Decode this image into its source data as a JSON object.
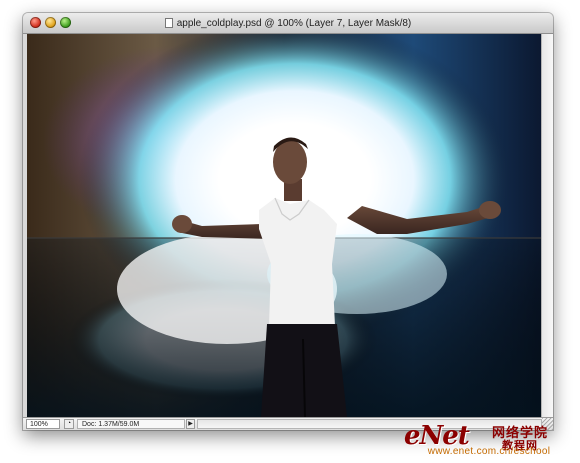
{
  "window": {
    "title": "apple_coldplay.psd @ 100% (Layer 7, Layer Mask/8)"
  },
  "status_bar": {
    "zoom": "100%",
    "doc_info": "Doc: 1.37M/59.0M"
  },
  "watermark": {
    "logo": "eNet",
    "cn_text": "网络学院",
    "sub": "教程网",
    "url": "www.enet.com.cn/eschool"
  }
}
